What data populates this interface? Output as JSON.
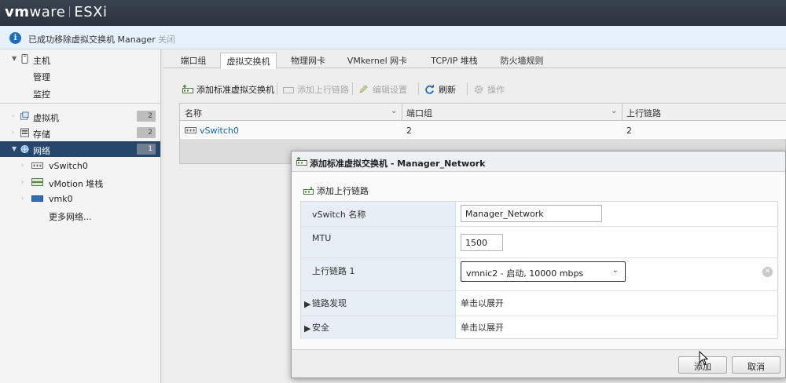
{
  "header": {
    "brand_vm": "vm",
    "brand_ware": "ware",
    "brand_product": "ESXi"
  },
  "notice": {
    "message": "已成功移除虚拟交换机 Manager",
    "close_label": "关闭"
  },
  "sidebar": {
    "host": "主机",
    "manage": "管理",
    "monitor": "监控",
    "vms": {
      "label": "虚拟机",
      "count": "2"
    },
    "storage": {
      "label": "存储",
      "count": "2"
    },
    "network": {
      "label": "网络",
      "count": "1"
    },
    "network_items": [
      "vSwitch0",
      "vMotion 堆栈",
      "vmk0",
      "更多网络..."
    ]
  },
  "tabs": [
    "端口组",
    "虚拟交换机",
    "物理网卡",
    "VMkernel 网卡",
    "TCP/IP 堆栈",
    "防火墙规则"
  ],
  "toolbar": {
    "add_vswitch": "添加标准虚拟交换机",
    "add_uplink": "添加上行链路",
    "edit": "编辑设置",
    "refresh": "刷新",
    "actions": "操作"
  },
  "table": {
    "columns": [
      "名称",
      "端口组",
      "上行链路"
    ],
    "rows": [
      {
        "name": "vSwitch0",
        "portgroups": "2",
        "uplinks": "2"
      }
    ]
  },
  "dialog": {
    "title": "添加标准虚拟交换机 - Manager_Network",
    "section": "添加上行链路",
    "fields": {
      "vswitch_name": {
        "label": "vSwitch 名称",
        "value": "Manager_Network"
      },
      "mtu": {
        "label": "MTU",
        "value": "1500"
      },
      "uplink1": {
        "label": "上行链路 1",
        "value": "vmnic2 - 启动, 10000 mbps"
      },
      "link_discovery": {
        "label": "链路发现",
        "value": "单击以展开"
      },
      "security": {
        "label": "安全",
        "value": "单击以展开"
      }
    },
    "buttons": {
      "add": "添加",
      "cancel": "取消"
    }
  },
  "colors": {
    "header_bg": "#2f3844",
    "active_nav": "#26466b",
    "link": "#1565a8",
    "info": "#1e6fb8"
  }
}
